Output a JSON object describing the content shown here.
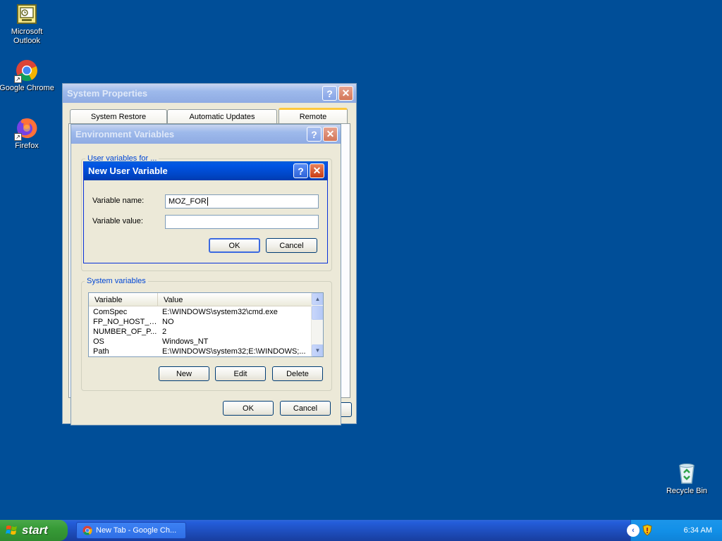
{
  "desktop": {
    "icons": [
      {
        "label_line1": "Microsoft",
        "label_line2": "Outlook",
        "icon": "outlook-icon"
      },
      {
        "label_line1": "Google Chrome",
        "label_line2": "",
        "icon": "chrome-icon"
      },
      {
        "label_line1": "Firefox",
        "label_line2": "",
        "icon": "firefox-icon"
      },
      {
        "label_line1": "Recycle Bin",
        "label_line2": "",
        "icon": "recycle-bin-icon"
      }
    ]
  },
  "system_properties": {
    "title": "System Properties",
    "tabs": [
      "System Restore",
      "Automatic Updates",
      "Remote"
    ]
  },
  "env_vars": {
    "title": "Environment Variables",
    "user_group_label": "User variables for ...",
    "system_group_label": "System variables",
    "columns": [
      "Variable",
      "Value"
    ],
    "rows": [
      {
        "variable": "ComSpec",
        "value": "E:\\WINDOWS\\system32\\cmd.exe"
      },
      {
        "variable": "FP_NO_HOST_C...",
        "value": "NO"
      },
      {
        "variable": "NUMBER_OF_P...",
        "value": "2"
      },
      {
        "variable": "OS",
        "value": "Windows_NT"
      },
      {
        "variable": "Path",
        "value": "E:\\WINDOWS\\system32;E:\\WINDOWS;..."
      }
    ],
    "new_label": "New",
    "edit_label": "Edit",
    "delete_label": "Delete",
    "ok_label": "OK",
    "cancel_label": "Cancel"
  },
  "new_user_var": {
    "title": "New User Variable",
    "name_label": "Variable name:",
    "name_value": "MOZ_FOR",
    "value_label": "Variable value:",
    "value_value": "",
    "ok_label": "OK",
    "cancel_label": "Cancel"
  },
  "taskbar": {
    "start_label": "start",
    "task_label": "New Tab - Google Ch...",
    "clock": "6:34 AM"
  },
  "colors": {
    "desktop": "#004e98",
    "title_active": "#0055e5",
    "group_label": "#0046d5"
  }
}
